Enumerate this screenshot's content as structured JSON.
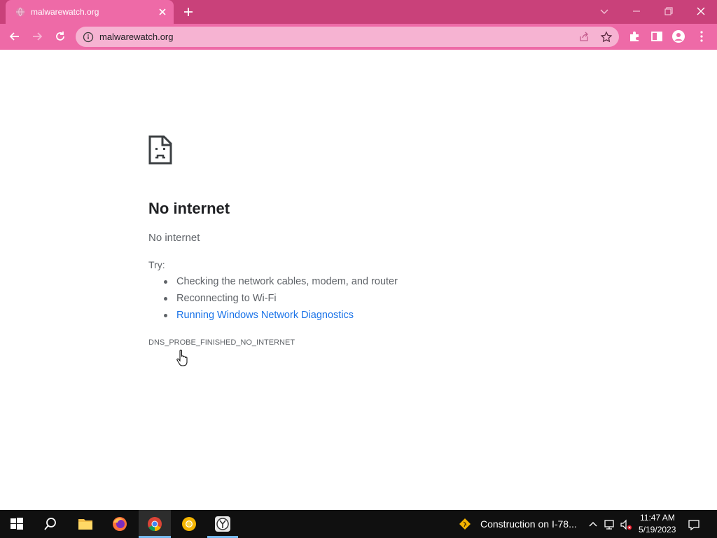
{
  "browser": {
    "tab": {
      "title": "malwarewatch.org"
    },
    "omnibox": {
      "url": "malwarewatch.org"
    },
    "colors": {
      "tabbar": "#c9417a",
      "toolbar": "#ee6aa7",
      "omnibox": "#f6b3d2"
    }
  },
  "error_page": {
    "title": "No internet",
    "subtitle": "No internet",
    "try_label": "Try:",
    "suggestions": [
      "Checking the network cables, modem, and router",
      "Reconnecting to Wi-Fi",
      "Running Windows Network Diagnostics"
    ],
    "error_code": "DNS_PROBE_FINISHED_NO_INTERNET",
    "link_color": "#1a73e8"
  },
  "taskbar": {
    "apps": [
      "start-icon",
      "search-icon",
      "file-explorer-icon",
      "firefox-icon",
      "chrome-icon",
      "chrome-canary-icon",
      "app-clock-icon"
    ],
    "news": "Construction on I-78...",
    "time": "11:47 AM",
    "date": "5/19/2023"
  }
}
